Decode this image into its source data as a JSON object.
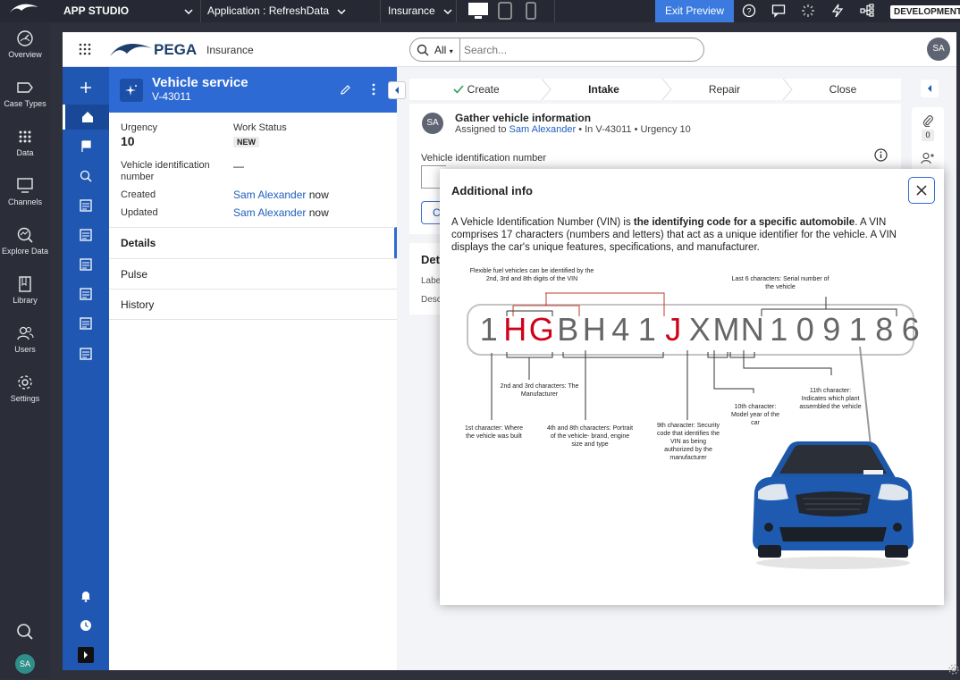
{
  "topbar": {
    "studio": "APP STUDIO",
    "application": "Application :  RefreshData",
    "workspace": "Insurance",
    "exit_preview": "Exit Preview",
    "environment": "DEVELOPMENT"
  },
  "studio_nav": [
    "Overview",
    "Case Types",
    "Data",
    "Channels",
    "Explore Data",
    "Library",
    "Users",
    "Settings"
  ],
  "studio_user": "SA",
  "app_header": {
    "brand": "PEGA",
    "app_name": "Insurance",
    "search_scope": "All",
    "search_placeholder": "Search...",
    "avatar": "SA"
  },
  "case": {
    "title": "Vehicle service",
    "id": "V-43011",
    "urgency_label": "Urgency",
    "urgency_value": "10",
    "status_label": "Work Status",
    "status_value": "NEW",
    "vin_label": "Vehicle identification number",
    "vin_value": "—",
    "created_label": "Created",
    "created_by": "Sam Alexander",
    "created_when": "now",
    "updated_label": "Updated",
    "updated_by": "Sam Alexander",
    "updated_when": "now",
    "sections": [
      "Details",
      "Pulse",
      "History"
    ]
  },
  "stages": [
    "Create",
    "Intake",
    "Repair",
    "Close"
  ],
  "task": {
    "avatar": "SA",
    "title": "Gather vehicle information",
    "assigned_prefix": "Assigned to",
    "assignee": "Sam Alexander",
    "meta": "• In V-43011 • Urgency 10",
    "field_label": "Vehicle identification number",
    "button_partial": "C"
  },
  "details_card": {
    "title_partial": "Det",
    "row1_partial": "Labe",
    "row2_partial": "Desc"
  },
  "right_strip": {
    "attachments_count": "0"
  },
  "modal": {
    "title": "Additional info",
    "text_before": "A Vehicle Identification Number (VIN) is ",
    "text_bold": "the identifying code for a specific automobile",
    "text_after": ". A VIN comprises 17 characters (numbers and letters) that act as a unique identifier for the vehicle. A VIN displays the car's unique features, specifications, and manufacturer.",
    "vin_chars": [
      "1",
      "H",
      "G",
      "B",
      "H",
      "4",
      "1",
      "J",
      "X",
      "M",
      "N",
      "1",
      "0",
      "9",
      "1",
      "8",
      "6"
    ],
    "highlight_color": "#d0021b",
    "annotations": {
      "flex_fuel": "Flexible fuel vehicles can be identified by the 2nd, 3rd and 8th digits of the VIN",
      "last6": "Last 6 characters: Serial number of the vehicle",
      "c23": "2nd and 3rd characters: The Manufacturer",
      "c1": "1st character: Where the vehicle was built",
      "c48": "4th and 8th characters: Portrait of the vehicle- brand, engine size and type",
      "c9": "9th character: Security code that identifies the VIN as being authorized by the manufacturer",
      "c10": "10th character: Model year of the car",
      "c11": "11th character: Indicates which plant assembled the vehicle"
    }
  }
}
